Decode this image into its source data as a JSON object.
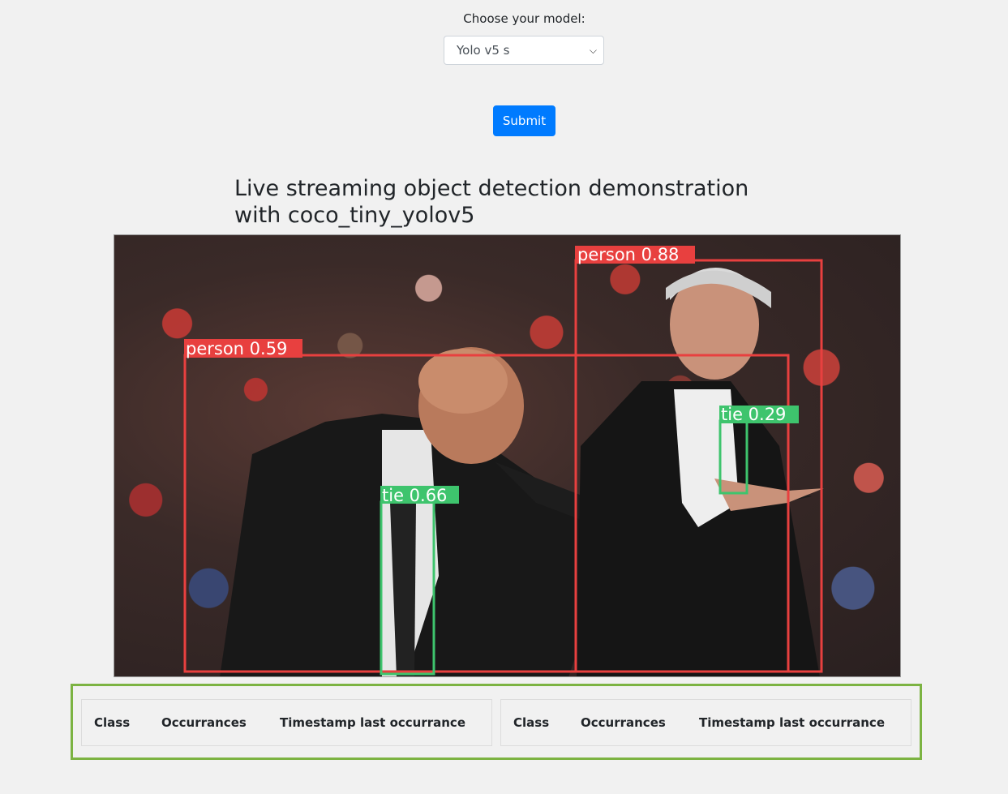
{
  "form": {
    "model_label": "Choose your model:",
    "model_selected": "Yolo v5 s",
    "submit_label": "Submit"
  },
  "stream": {
    "title": "Live streaming object detection demonstration with coco_tiny_yolov5",
    "detections": [
      {
        "label": "person 0.88",
        "class": "person",
        "confidence": 0.88,
        "color": "#e8403f"
      },
      {
        "label": "person 0.59",
        "class": "person",
        "confidence": 0.59,
        "color": "#e8403f"
      },
      {
        "label": "tie 0.29",
        "class": "tie",
        "confidence": 0.29,
        "color": "#3ec46d"
      },
      {
        "label": "tie 0.66",
        "class": "tie",
        "confidence": 0.66,
        "color": "#3ec46d"
      }
    ]
  },
  "tables": [
    {
      "headers": [
        "Class",
        "Occurrances",
        "Timestamp last occurrance"
      ]
    },
    {
      "headers": [
        "Class",
        "Occurrances",
        "Timestamp last occurrance"
      ]
    }
  ],
  "colors": {
    "accent": "#007bff",
    "panel_border": "#7cb342",
    "person_box": "#e8403f",
    "tie_box": "#3ec46d"
  }
}
